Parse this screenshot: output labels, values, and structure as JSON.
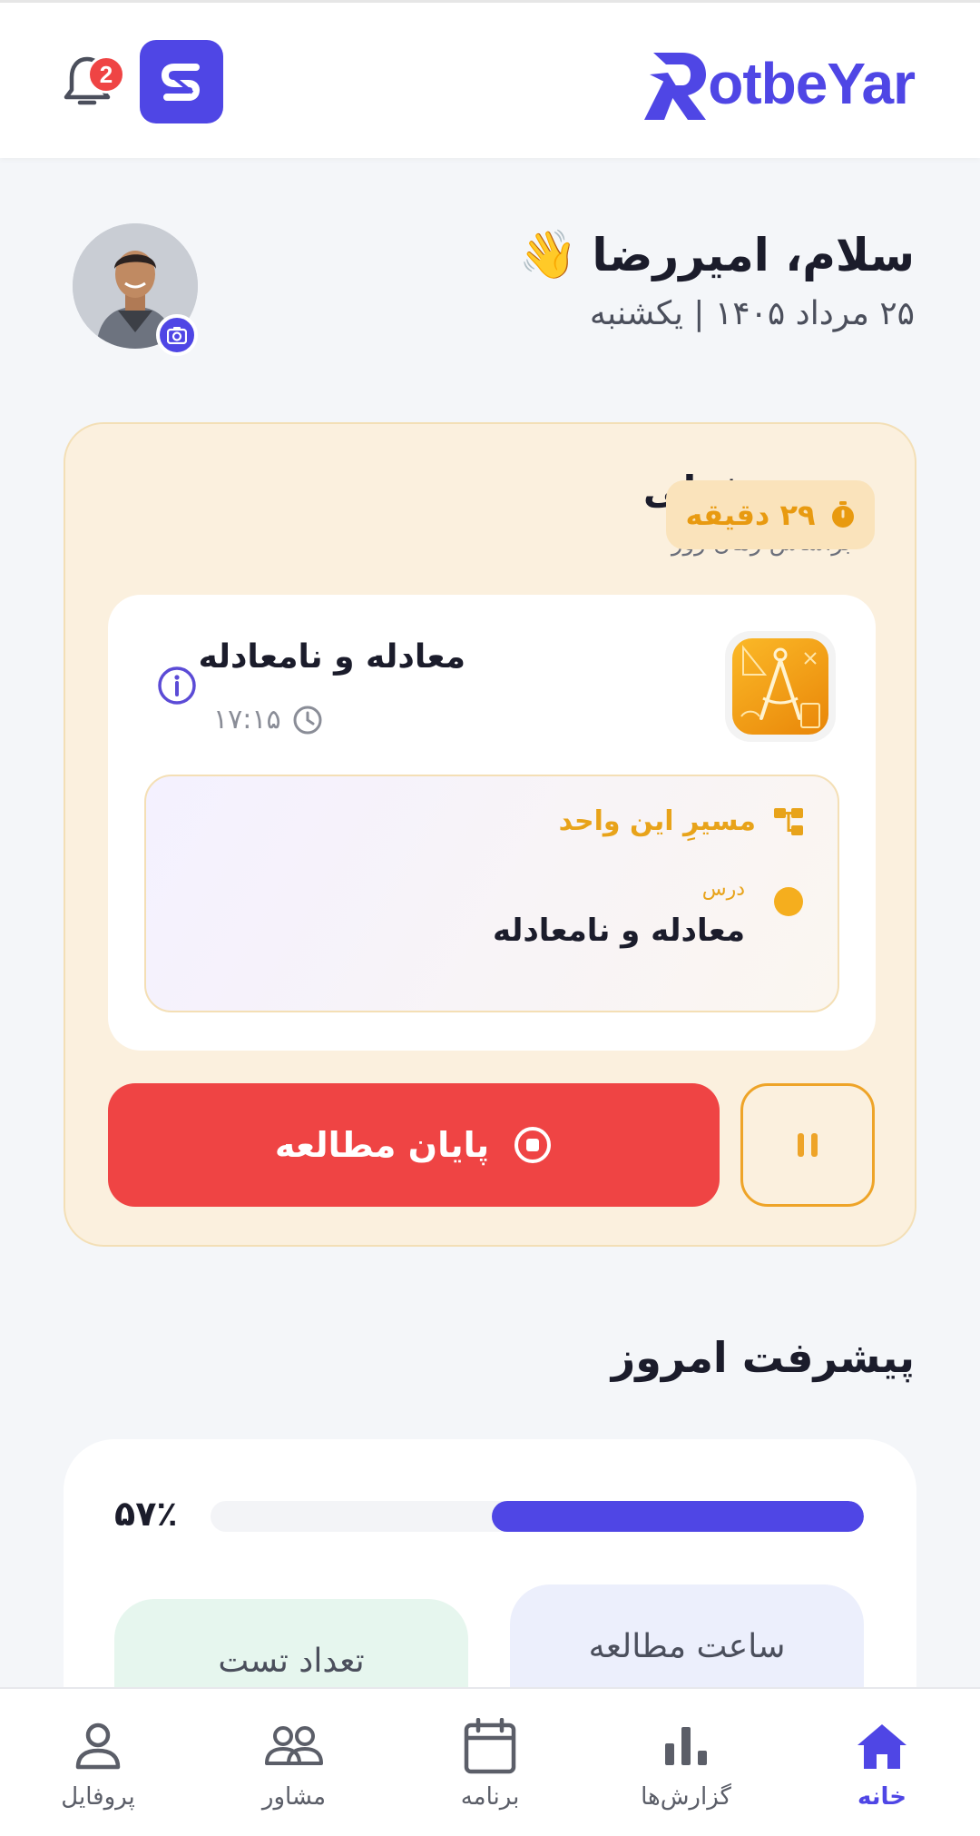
{
  "header": {
    "brand_text": "otbeYar",
    "notification_count": "2",
    "accent_color": "#4f46e5"
  },
  "greeting": {
    "title": "سلام، امیررضا",
    "wave": "👋",
    "date": "۲۵ مرداد ۱۴۰۵ | یکشنبه"
  },
  "current_lesson": {
    "title": "درس فعلی",
    "subtitle": "براساس زمان روز",
    "timer": "۲۹ دقیقه",
    "lesson_name": "معادله و نامعادله",
    "lesson_time": "۱۷:۱۵",
    "path_title": "مسیرِ این واحد",
    "path_label": "درس",
    "path_value": "معادله و نامعادله",
    "end_button": "پایان مطالعه"
  },
  "progress": {
    "section_title": "پیشرفت امروز",
    "percent_text": "۵۷٪",
    "percent_value": 57,
    "tiles": {
      "study_hours": "ساعت مطالعه",
      "test_count": "تعداد تست"
    }
  },
  "nav": {
    "home": "خانه",
    "reports": "گزارش‌ها",
    "program": "برنامه",
    "advisor": "مشاور",
    "profile": "پروفایل"
  }
}
